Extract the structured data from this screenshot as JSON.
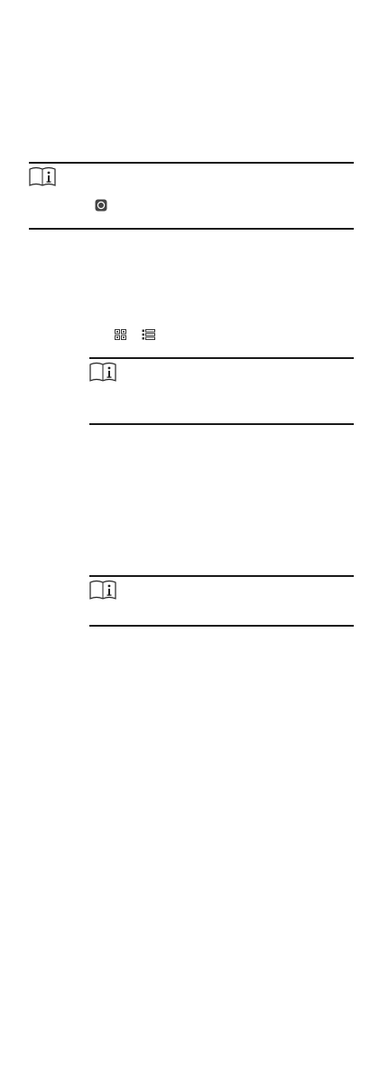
{
  "icons": {
    "note": "note-book-info-icon",
    "power": "power-circle-icon",
    "grid_view": "grid-view-icon",
    "list_view": "list-view-icon"
  },
  "colors": {
    "rule": "#1a1a1a",
    "icon_stroke": "#222222",
    "icon_fill": "#444444"
  }
}
